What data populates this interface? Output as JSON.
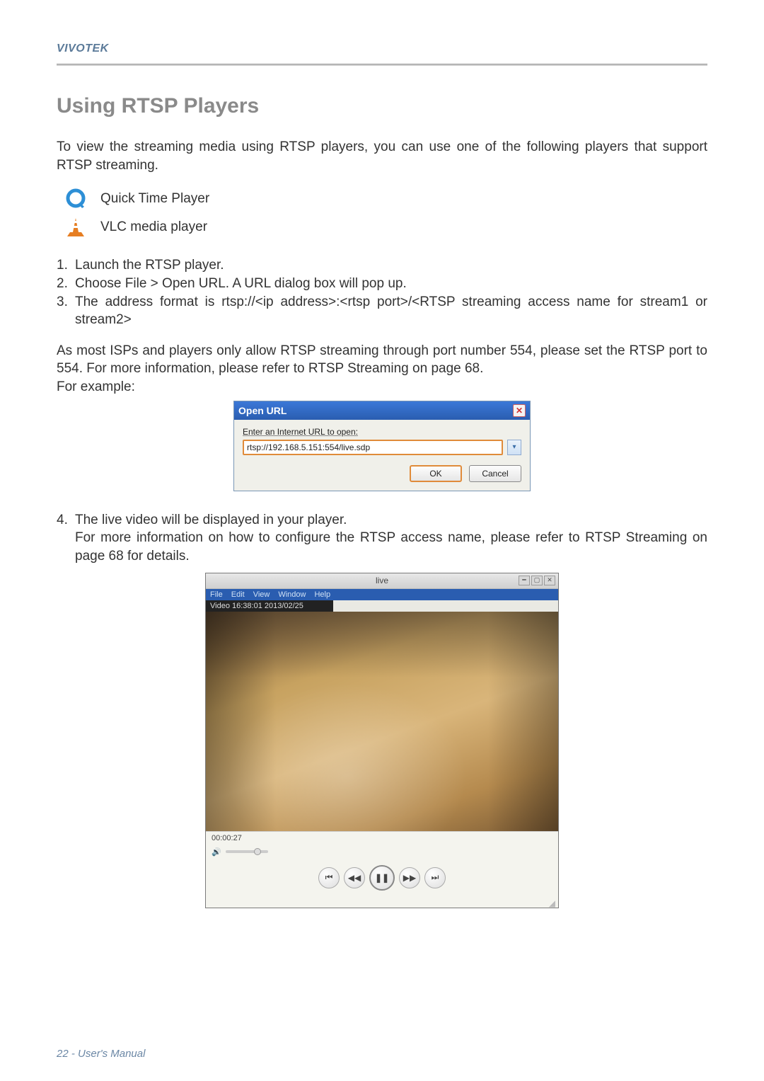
{
  "header": {
    "brand": "VIVOTEK"
  },
  "section": {
    "title": "Using RTSP Players"
  },
  "intro": "To view the streaming media using RTSP players, you can use one of the following players that support RTSP streaming.",
  "players": {
    "quicktime": "Quick Time Player",
    "vlc": "VLC media player"
  },
  "steps": {
    "s1": "Launch the RTSP player.",
    "s2": "Choose File > Open URL. A URL dialog box will pop up.",
    "s3": "The address format is rtsp://<ip address>:<rtsp port>/<RTSP streaming access name for stream1 or stream2>"
  },
  "note": "As most ISPs and players only allow RTSP streaming through port number 554, please set the RTSP port to 554. For more information, please refer to RTSP Streaming on page 68.",
  "for_example": "For example:",
  "dialog": {
    "title": "Open URL",
    "label": "Enter an Internet URL to open:",
    "url_prefix": "rtsp://192.168.5.151:",
    "url_port": "554",
    "url_suffix": "/live.sdp",
    "ok": "OK",
    "cancel": "Cancel"
  },
  "step4": {
    "num": "4.",
    "line1": "The live video will be displayed in your player.",
    "line2": "For more information on how to configure the RTSP access name, please refer to RTSP Streaming on page 68 for details."
  },
  "player_window": {
    "title": "live",
    "menu": {
      "file": "File",
      "edit": "Edit",
      "view": "View",
      "window": "Window",
      "help": "Help"
    },
    "overlay": "Video 16:38:01 2013/02/25",
    "time": "00:00:27"
  },
  "footer": {
    "page": "22",
    "label": "User's Manual"
  }
}
